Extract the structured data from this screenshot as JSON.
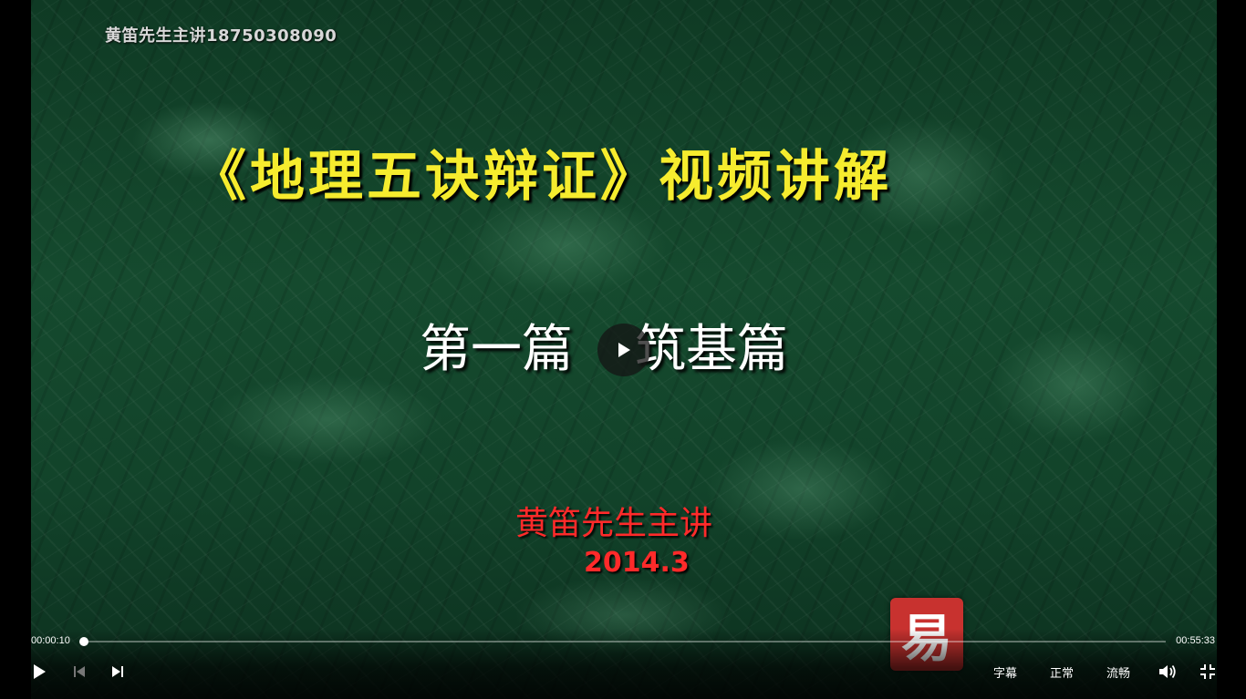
{
  "video": {
    "watermark": "黄笛先生主讲18750308090",
    "title": "《地理五诀辩证》视频讲解",
    "subtitle_left": "第一篇",
    "subtitle_right": "筑基篇",
    "presenter": "黄笛先生主讲",
    "date": "2014.3",
    "logo_glyph": "易",
    "logo_color": "#c8322f",
    "title_color": "#f6ec2e",
    "presenter_color": "#ff2a2a"
  },
  "controls": {
    "current_time": "00:00:10",
    "total_time": "00:55:33",
    "progress_fraction": 0.003,
    "play_icon": "play-icon",
    "prev_icon": "skip-previous-icon",
    "next_icon": "skip-next-icon",
    "subtitle_label": "字幕",
    "speed_label": "正常",
    "quality_label": "流畅",
    "volume_icon": "volume-icon",
    "exit_fullscreen_icon": "exit-fullscreen-icon"
  }
}
